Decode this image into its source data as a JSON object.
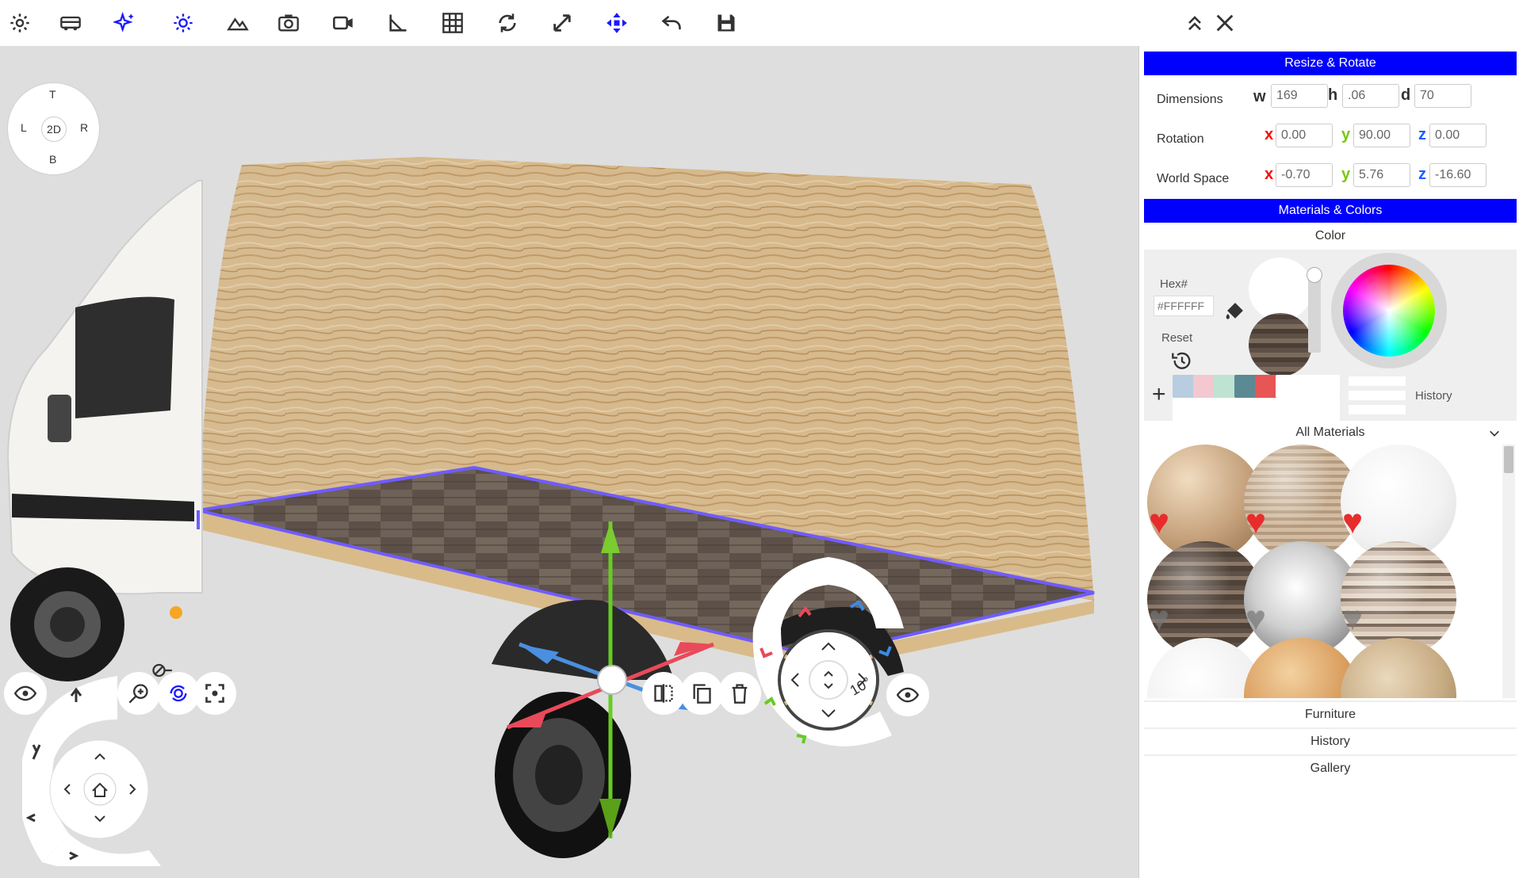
{
  "toolbar": {
    "icons": [
      "settings-icon",
      "van-icon",
      "sparkle-icon",
      "sun-icon",
      "terrain-icon",
      "camera-icon",
      "video-icon",
      "measure-icon",
      "grid-icon",
      "rotate-icon",
      "resize-icon",
      "move-icon",
      "undo-icon",
      "save-icon"
    ],
    "right_icons": [
      "collapse-up-icon",
      "close-icon"
    ],
    "accent": "#1a1aff"
  },
  "nav_cube": {
    "top": "T",
    "bottom": "B",
    "left": "L",
    "right": "R",
    "center": "2D"
  },
  "resize_rotate": {
    "title": "Resize & Rotate",
    "dimensions": {
      "label": "Dimensions",
      "w_label": "w",
      "h_label": "h",
      "d_label": "d",
      "w": "169",
      "h": ".06",
      "d": "70"
    },
    "rotation": {
      "label": "Rotation",
      "x_label": "x",
      "y_label": "y",
      "z_label": "z",
      "x": "0.00",
      "y": "90.00",
      "z": "0.00"
    },
    "world_space": {
      "label": "World Space",
      "x_label": "x",
      "y_label": "y",
      "z_label": "z",
      "x": "-0.70",
      "y": "5.76",
      "z": "-16.60"
    },
    "axis_colors": {
      "x": "#ff0000",
      "y": "#7ac70c",
      "z": "#1a5cff"
    }
  },
  "materials_colors": {
    "title": "Materials & Colors",
    "color_label": "Color",
    "hex_label": "Hex#",
    "hex_placeholder": "#FFFFFF",
    "reset_label": "Reset",
    "add_label": "+",
    "history_label": "History",
    "swatches": [
      "#b8cde0",
      "#f3c8d0",
      "#bfe3d3",
      "#5b8a94",
      "#e85555"
    ],
    "materials_dropdown": "All Materials"
  },
  "bottom_sections": {
    "furniture": "Furniture",
    "history": "History",
    "gallery": "Gallery"
  },
  "rotation_dial": {
    "angle": "10°"
  },
  "header_color": "#0000ff"
}
